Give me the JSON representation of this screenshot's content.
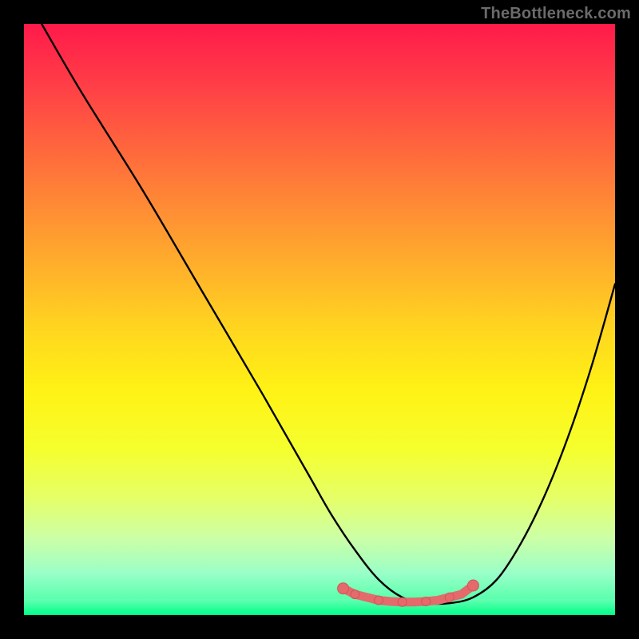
{
  "watermark": "TheBottleneck.com",
  "colors": {
    "curve": "#000000",
    "marker_fill": "#e46a6c",
    "marker_stroke": "#d25456",
    "background_black": "#000000"
  },
  "chart_data": {
    "type": "line",
    "title": "",
    "xlabel": "",
    "ylabel": "",
    "xlim": [
      0,
      100
    ],
    "ylim": [
      0,
      100
    ],
    "note": "No axes, ticks, or labels are rendered in the image. Values are estimated from pixel positions within the plotting rectangle.",
    "series": [
      {
        "name": "curve",
        "x": [
          3,
          10,
          20,
          30,
          40,
          48,
          52,
          56,
          60,
          64,
          68,
          72,
          76,
          80,
          84,
          88,
          92,
          96,
          100
        ],
        "y": [
          100,
          88,
          72,
          55,
          38,
          24,
          17,
          11,
          6,
          3,
          2,
          2,
          3,
          6,
          12,
          20,
          30,
          42,
          56
        ]
      }
    ],
    "markers": {
      "name": "bottom-cluster",
      "x": [
        54,
        56,
        58,
        60,
        62,
        64,
        66,
        68,
        70,
        72,
        74,
        76
      ],
      "y": [
        4.5,
        3.5,
        3.0,
        2.5,
        2.3,
        2.2,
        2.2,
        2.3,
        2.5,
        3.0,
        3.5,
        5.0
      ]
    }
  }
}
